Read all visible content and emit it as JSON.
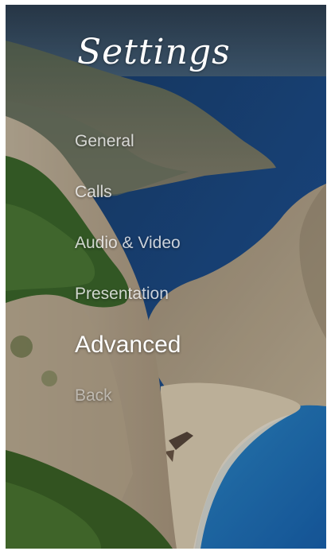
{
  "settings": {
    "title": "Settings",
    "menu": [
      {
        "label": "General"
      },
      {
        "label": "Calls"
      },
      {
        "label": "Audio & Video"
      },
      {
        "label": "Presentation"
      },
      {
        "label": "Advanced"
      },
      {
        "label": "Back"
      }
    ],
    "active_item": "Advanced"
  },
  "colors": {
    "sky": "#3b5a78",
    "sea": "#1c5aa8",
    "lagoon": "#2a9ad6",
    "cliff": "#b7a88f",
    "vegetation": "#3f6a2d",
    "sand": "#e6d8bd",
    "text": "#ffffff"
  }
}
